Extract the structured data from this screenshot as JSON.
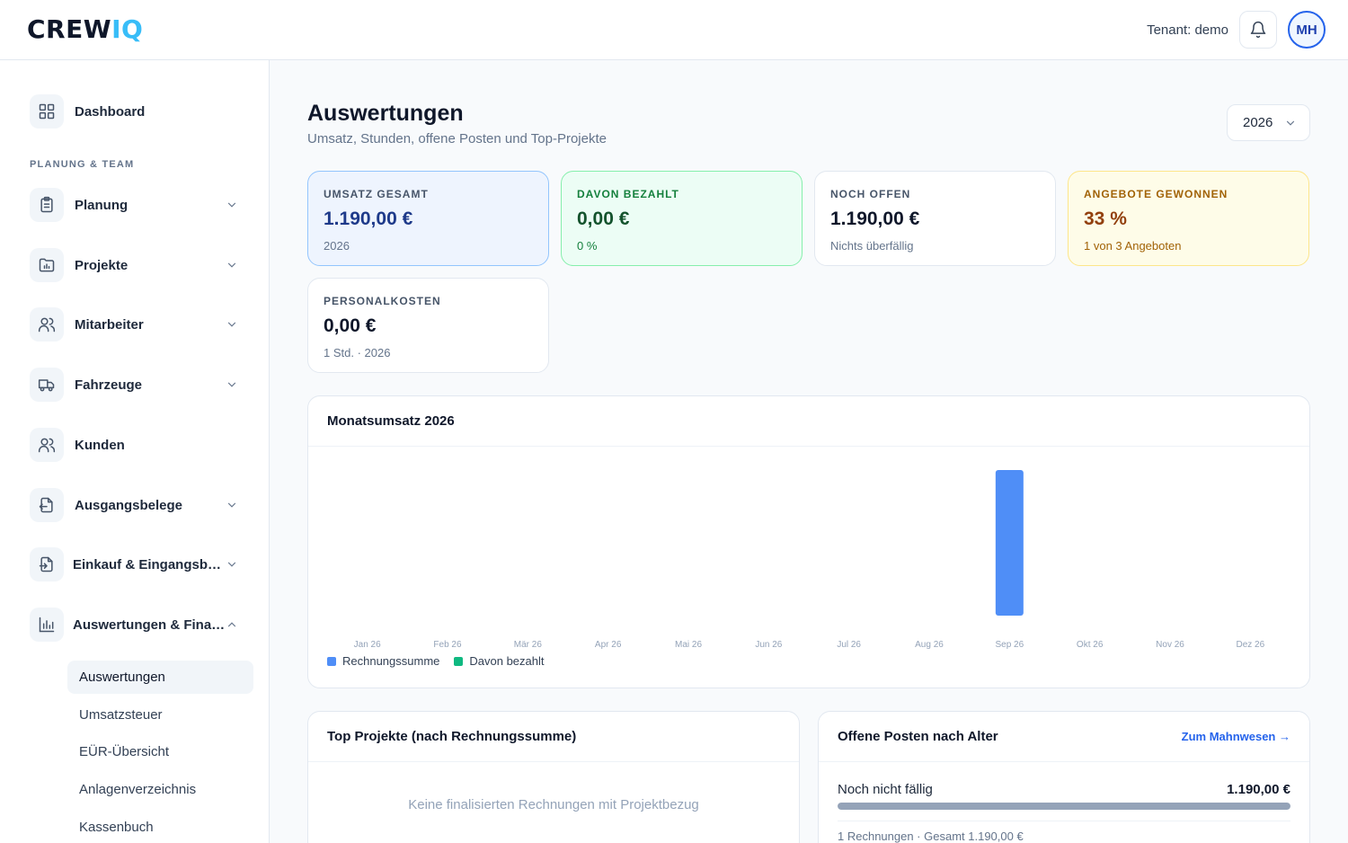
{
  "header": {
    "logo_main": "CREW",
    "logo_accent": "IQ",
    "tenant": "Tenant: demo",
    "avatar_initials": "MH"
  },
  "sidebar": {
    "section_title": "PLANUNG & TEAM",
    "items": [
      {
        "label": "Dashboard",
        "icon": "grid-icon"
      },
      {
        "label": "Planung",
        "icon": "clipboard-icon"
      },
      {
        "label": "Projekte",
        "icon": "folder-chart-icon"
      },
      {
        "label": "Mitarbeiter",
        "icon": "users-icon"
      },
      {
        "label": "Fahrzeuge",
        "icon": "truck-icon"
      },
      {
        "label": "Kunden",
        "icon": "users-icon"
      },
      {
        "label": "Ausgangsbelege",
        "icon": "file-out-icon"
      },
      {
        "label": "Einkauf & Eingangsbel…",
        "icon": "file-in-icon"
      },
      {
        "label": "Auswertungen & Fina…",
        "icon": "bar-chart-icon"
      }
    ],
    "subitems": [
      "Auswertungen",
      "Umsatzsteuer",
      "EÜR-Übersicht",
      "Anlagenverzeichnis",
      "Kassenbuch"
    ]
  },
  "page": {
    "title": "Auswertungen",
    "subtitle": "Umsatz, Stunden, offene Posten und Top-Projekte",
    "year": "2026"
  },
  "kpis": [
    {
      "label": "UMSATZ GESAMT",
      "value": "1.190,00 €",
      "sub": "2026"
    },
    {
      "label": "DAVON BEZAHLT",
      "value": "0,00 €",
      "sub": "0 %"
    },
    {
      "label": "NOCH OFFEN",
      "value": "1.190,00 €",
      "sub": "Nichts überfällig"
    },
    {
      "label": "ANGEBOTE GEWONNEN",
      "value": "33 %",
      "sub": "1 von 3 Angeboten"
    },
    {
      "label": "PERSONALKOSTEN",
      "value": "0,00 €",
      "sub": "1 Std. · 2026"
    }
  ],
  "colors": {
    "invoice": "#4f8ef7",
    "paid": "#10b981",
    "accent": "#2563eb"
  },
  "chart_data": {
    "type": "bar",
    "title": "Monatsumsatz 2026",
    "categories": [
      "Jan 26",
      "Feb 26",
      "Mär 26",
      "Apr 26",
      "Mai 26",
      "Jun 26",
      "Jul 26",
      "Aug 26",
      "Sep 26",
      "Okt 26",
      "Nov 26",
      "Dez 26"
    ],
    "series": [
      {
        "name": "Rechnungssumme",
        "color": "#4f8ef7",
        "values": [
          0,
          0,
          0,
          0,
          0,
          0,
          0,
          0,
          1190,
          0,
          0,
          0
        ]
      },
      {
        "name": "Davon bezahlt",
        "color": "#10b981",
        "values": [
          0,
          0,
          0,
          0,
          0,
          0,
          0,
          0,
          0,
          0,
          0,
          0
        ]
      }
    ],
    "ylim": [
      0,
      1190
    ],
    "grid": false,
    "legend": "bottom-left"
  },
  "top_projects": {
    "title": "Top Projekte (nach Rechnungssumme)",
    "empty": "Keine finalisierten Rechnungen mit Projektbezug"
  },
  "open_items": {
    "title": "Offene Posten nach Alter",
    "link": "Zum Mahnwesen →",
    "row_label": "Noch nicht fällig",
    "row_value": "1.190,00 €",
    "row_share": 1.0,
    "meta": "1 Rechnungen · Gesamt 1.190,00 €"
  }
}
